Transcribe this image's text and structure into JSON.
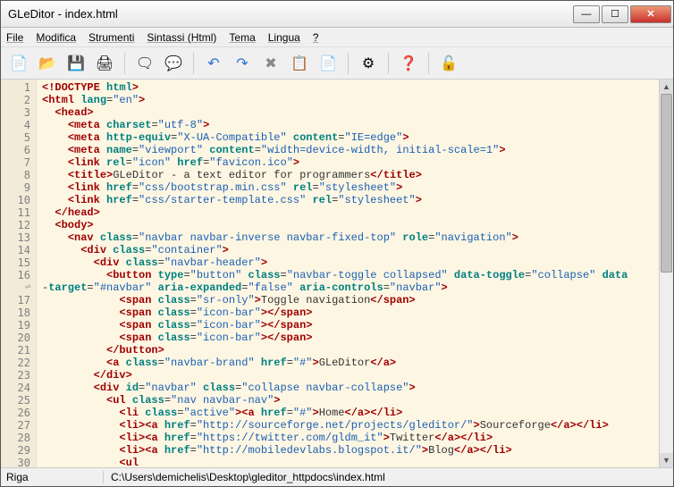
{
  "title": "GLeDitor - index.html",
  "menu": [
    "File",
    "Modifica",
    "Strumenti",
    "Sintassi (Html)",
    "Tema",
    "Lingua",
    "?"
  ],
  "toolbar": [
    {
      "icon": "📄",
      "name": "new-file"
    },
    {
      "icon": "📂",
      "name": "open-file"
    },
    {
      "icon": "💾",
      "name": "save-file"
    },
    {
      "icon": "🖨",
      "name": "print"
    },
    {
      "sep": true
    },
    {
      "icon": "🗨",
      "name": "find"
    },
    {
      "icon": "💬",
      "name": "replace"
    },
    {
      "sep": true
    },
    {
      "icon": "↶",
      "name": "undo",
      "color": "#2a6fd6"
    },
    {
      "icon": "↷",
      "name": "redo",
      "color": "#2a6fd6"
    },
    {
      "icon": "✖",
      "name": "cut",
      "color": "#888"
    },
    {
      "icon": "📋",
      "name": "copy"
    },
    {
      "icon": "📄",
      "name": "paste"
    },
    {
      "sep": true
    },
    {
      "icon": "⚙",
      "name": "settings"
    },
    {
      "sep": true
    },
    {
      "icon": "❓",
      "name": "help",
      "color": "#2a6fd6"
    },
    {
      "sep": true
    },
    {
      "icon": "🔓",
      "name": "lock"
    }
  ],
  "lines": [
    [
      {
        "t": "ang",
        "v": "<!"
      },
      {
        "t": "tag",
        "v": "DOCTYPE"
      },
      {
        "t": "txt",
        "v": " "
      },
      {
        "t": "attr",
        "v": "html"
      },
      {
        "t": "ang",
        "v": ">"
      }
    ],
    [
      {
        "t": "ang",
        "v": "<"
      },
      {
        "t": "tag",
        "v": "html"
      },
      {
        "t": "txt",
        "v": " "
      },
      {
        "t": "attr",
        "v": "lang"
      },
      {
        "t": "txt",
        "v": "="
      },
      {
        "t": "str",
        "v": "\"en\""
      },
      {
        "t": "ang",
        "v": ">"
      }
    ],
    [
      {
        "t": "txt",
        "v": "  "
      },
      {
        "t": "ang",
        "v": "<"
      },
      {
        "t": "tag",
        "v": "head"
      },
      {
        "t": "ang",
        "v": ">"
      }
    ],
    [
      {
        "t": "txt",
        "v": "    "
      },
      {
        "t": "ang",
        "v": "<"
      },
      {
        "t": "tag",
        "v": "meta"
      },
      {
        "t": "txt",
        "v": " "
      },
      {
        "t": "attr",
        "v": "charset"
      },
      {
        "t": "txt",
        "v": "="
      },
      {
        "t": "str",
        "v": "\"utf-8\""
      },
      {
        "t": "ang",
        "v": ">"
      }
    ],
    [
      {
        "t": "txt",
        "v": "    "
      },
      {
        "t": "ang",
        "v": "<"
      },
      {
        "t": "tag",
        "v": "meta"
      },
      {
        "t": "txt",
        "v": " "
      },
      {
        "t": "attr",
        "v": "http-equiv"
      },
      {
        "t": "txt",
        "v": "="
      },
      {
        "t": "str",
        "v": "\"X-UA-Compatible\""
      },
      {
        "t": "txt",
        "v": " "
      },
      {
        "t": "attr",
        "v": "content"
      },
      {
        "t": "txt",
        "v": "="
      },
      {
        "t": "str",
        "v": "\"IE=edge\""
      },
      {
        "t": "ang",
        "v": ">"
      }
    ],
    [
      {
        "t": "txt",
        "v": "    "
      },
      {
        "t": "ang",
        "v": "<"
      },
      {
        "t": "tag",
        "v": "meta"
      },
      {
        "t": "txt",
        "v": " "
      },
      {
        "t": "attr",
        "v": "name"
      },
      {
        "t": "txt",
        "v": "="
      },
      {
        "t": "str",
        "v": "\"viewport\""
      },
      {
        "t": "txt",
        "v": " "
      },
      {
        "t": "attr",
        "v": "content"
      },
      {
        "t": "txt",
        "v": "="
      },
      {
        "t": "str",
        "v": "\"width=device-width, initial-scale=1\""
      },
      {
        "t": "ang",
        "v": ">"
      }
    ],
    [
      {
        "t": "txt",
        "v": "    "
      },
      {
        "t": "ang",
        "v": "<"
      },
      {
        "t": "tag",
        "v": "link"
      },
      {
        "t": "txt",
        "v": " "
      },
      {
        "t": "attr",
        "v": "rel"
      },
      {
        "t": "txt",
        "v": "="
      },
      {
        "t": "str",
        "v": "\"icon\""
      },
      {
        "t": "txt",
        "v": " "
      },
      {
        "t": "attr",
        "v": "href"
      },
      {
        "t": "txt",
        "v": "="
      },
      {
        "t": "str",
        "v": "\"favicon.ico\""
      },
      {
        "t": "ang",
        "v": ">"
      }
    ],
    [
      {
        "t": "txt",
        "v": "    "
      },
      {
        "t": "ang",
        "v": "<"
      },
      {
        "t": "tag",
        "v": "title"
      },
      {
        "t": "ang",
        "v": ">"
      },
      {
        "t": "txt",
        "v": "GLeDitor - a text editor for programmers"
      },
      {
        "t": "ang",
        "v": "</"
      },
      {
        "t": "tag",
        "v": "title"
      },
      {
        "t": "ang",
        "v": ">"
      }
    ],
    [
      {
        "t": "txt",
        "v": "    "
      },
      {
        "t": "ang",
        "v": "<"
      },
      {
        "t": "tag",
        "v": "link"
      },
      {
        "t": "txt",
        "v": " "
      },
      {
        "t": "attr",
        "v": "href"
      },
      {
        "t": "txt",
        "v": "="
      },
      {
        "t": "str",
        "v": "\"css/bootstrap.min.css\""
      },
      {
        "t": "txt",
        "v": " "
      },
      {
        "t": "attr",
        "v": "rel"
      },
      {
        "t": "txt",
        "v": "="
      },
      {
        "t": "str",
        "v": "\"stylesheet\""
      },
      {
        "t": "ang",
        "v": ">"
      }
    ],
    [
      {
        "t": "txt",
        "v": "    "
      },
      {
        "t": "ang",
        "v": "<"
      },
      {
        "t": "tag",
        "v": "link"
      },
      {
        "t": "txt",
        "v": " "
      },
      {
        "t": "attr",
        "v": "href"
      },
      {
        "t": "txt",
        "v": "="
      },
      {
        "t": "str",
        "v": "\"css/starter-template.css\""
      },
      {
        "t": "txt",
        "v": " "
      },
      {
        "t": "attr",
        "v": "rel"
      },
      {
        "t": "txt",
        "v": "="
      },
      {
        "t": "str",
        "v": "\"stylesheet\""
      },
      {
        "t": "ang",
        "v": ">"
      }
    ],
    [
      {
        "t": "txt",
        "v": "  "
      },
      {
        "t": "ang",
        "v": "</"
      },
      {
        "t": "tag",
        "v": "head"
      },
      {
        "t": "ang",
        "v": ">"
      }
    ],
    [
      {
        "t": "txt",
        "v": "  "
      },
      {
        "t": "ang",
        "v": "<"
      },
      {
        "t": "tag",
        "v": "body"
      },
      {
        "t": "ang",
        "v": ">"
      }
    ],
    [
      {
        "t": "txt",
        "v": "    "
      },
      {
        "t": "ang",
        "v": "<"
      },
      {
        "t": "tag",
        "v": "nav"
      },
      {
        "t": "txt",
        "v": " "
      },
      {
        "t": "attr",
        "v": "class"
      },
      {
        "t": "txt",
        "v": "="
      },
      {
        "t": "str",
        "v": "\"navbar navbar-inverse navbar-fixed-top\""
      },
      {
        "t": "txt",
        "v": " "
      },
      {
        "t": "attr",
        "v": "role"
      },
      {
        "t": "txt",
        "v": "="
      },
      {
        "t": "str",
        "v": "\"navigation\""
      },
      {
        "t": "ang",
        "v": ">"
      }
    ],
    [
      {
        "t": "txt",
        "v": "      "
      },
      {
        "t": "ang",
        "v": "<"
      },
      {
        "t": "tag",
        "v": "div"
      },
      {
        "t": "txt",
        "v": " "
      },
      {
        "t": "attr",
        "v": "class"
      },
      {
        "t": "txt",
        "v": "="
      },
      {
        "t": "str",
        "v": "\"container\""
      },
      {
        "t": "ang",
        "v": ">"
      }
    ],
    [
      {
        "t": "txt",
        "v": "        "
      },
      {
        "t": "ang",
        "v": "<"
      },
      {
        "t": "tag",
        "v": "div"
      },
      {
        "t": "txt",
        "v": " "
      },
      {
        "t": "attr",
        "v": "class"
      },
      {
        "t": "txt",
        "v": "="
      },
      {
        "t": "str",
        "v": "\"navbar-header\""
      },
      {
        "t": "ang",
        "v": ">"
      }
    ],
    [
      {
        "t": "txt",
        "v": "          "
      },
      {
        "t": "ang",
        "v": "<"
      },
      {
        "t": "tag",
        "v": "button"
      },
      {
        "t": "txt",
        "v": " "
      },
      {
        "t": "attr",
        "v": "type"
      },
      {
        "t": "txt",
        "v": "="
      },
      {
        "t": "str",
        "v": "\"button\""
      },
      {
        "t": "txt",
        "v": " "
      },
      {
        "t": "attr",
        "v": "class"
      },
      {
        "t": "txt",
        "v": "="
      },
      {
        "t": "str",
        "v": "\"navbar-toggle collapsed\""
      },
      {
        "t": "txt",
        "v": " "
      },
      {
        "t": "attr",
        "v": "data-toggle"
      },
      {
        "t": "txt",
        "v": "="
      },
      {
        "t": "str",
        "v": "\"collapse\""
      },
      {
        "t": "txt",
        "v": " "
      },
      {
        "t": "attr",
        "v": "data"
      }
    ],
    [
      {
        "t": "txt",
        "v": "-"
      },
      {
        "t": "attr",
        "v": "target"
      },
      {
        "t": "txt",
        "v": "="
      },
      {
        "t": "str",
        "v": "\"#navbar\""
      },
      {
        "t": "txt",
        "v": " "
      },
      {
        "t": "attr",
        "v": "aria-expanded"
      },
      {
        "t": "txt",
        "v": "="
      },
      {
        "t": "str",
        "v": "\"false\""
      },
      {
        "t": "txt",
        "v": " "
      },
      {
        "t": "attr",
        "v": "aria-controls"
      },
      {
        "t": "txt",
        "v": "="
      },
      {
        "t": "str",
        "v": "\"navbar\""
      },
      {
        "t": "ang",
        "v": ">"
      }
    ],
    [
      {
        "t": "txt",
        "v": "            "
      },
      {
        "t": "ang",
        "v": "<"
      },
      {
        "t": "tag",
        "v": "span"
      },
      {
        "t": "txt",
        "v": " "
      },
      {
        "t": "attr",
        "v": "class"
      },
      {
        "t": "txt",
        "v": "="
      },
      {
        "t": "str",
        "v": "\"sr-only\""
      },
      {
        "t": "ang",
        "v": ">"
      },
      {
        "t": "txt",
        "v": "Toggle navigation"
      },
      {
        "t": "ang",
        "v": "</"
      },
      {
        "t": "tag",
        "v": "span"
      },
      {
        "t": "ang",
        "v": ">"
      }
    ],
    [
      {
        "t": "txt",
        "v": "            "
      },
      {
        "t": "ang",
        "v": "<"
      },
      {
        "t": "tag",
        "v": "span"
      },
      {
        "t": "txt",
        "v": " "
      },
      {
        "t": "attr",
        "v": "class"
      },
      {
        "t": "txt",
        "v": "="
      },
      {
        "t": "str",
        "v": "\"icon-bar\""
      },
      {
        "t": "ang",
        "v": "></"
      },
      {
        "t": "tag",
        "v": "span"
      },
      {
        "t": "ang",
        "v": ">"
      }
    ],
    [
      {
        "t": "txt",
        "v": "            "
      },
      {
        "t": "ang",
        "v": "<"
      },
      {
        "t": "tag",
        "v": "span"
      },
      {
        "t": "txt",
        "v": " "
      },
      {
        "t": "attr",
        "v": "class"
      },
      {
        "t": "txt",
        "v": "="
      },
      {
        "t": "str",
        "v": "\"icon-bar\""
      },
      {
        "t": "ang",
        "v": "></"
      },
      {
        "t": "tag",
        "v": "span"
      },
      {
        "t": "ang",
        "v": ">"
      }
    ],
    [
      {
        "t": "txt",
        "v": "            "
      },
      {
        "t": "ang",
        "v": "<"
      },
      {
        "t": "tag",
        "v": "span"
      },
      {
        "t": "txt",
        "v": " "
      },
      {
        "t": "attr",
        "v": "class"
      },
      {
        "t": "txt",
        "v": "="
      },
      {
        "t": "str",
        "v": "\"icon-bar\""
      },
      {
        "t": "ang",
        "v": "></"
      },
      {
        "t": "tag",
        "v": "span"
      },
      {
        "t": "ang",
        "v": ">"
      }
    ],
    [
      {
        "t": "txt",
        "v": "          "
      },
      {
        "t": "ang",
        "v": "</"
      },
      {
        "t": "tag",
        "v": "button"
      },
      {
        "t": "ang",
        "v": ">"
      }
    ],
    [
      {
        "t": "txt",
        "v": "          "
      },
      {
        "t": "ang",
        "v": "<"
      },
      {
        "t": "tag",
        "v": "a"
      },
      {
        "t": "txt",
        "v": " "
      },
      {
        "t": "attr",
        "v": "class"
      },
      {
        "t": "txt",
        "v": "="
      },
      {
        "t": "str",
        "v": "\"navbar-brand\""
      },
      {
        "t": "txt",
        "v": " "
      },
      {
        "t": "attr",
        "v": "href"
      },
      {
        "t": "txt",
        "v": "="
      },
      {
        "t": "str",
        "v": "\"#\""
      },
      {
        "t": "ang",
        "v": ">"
      },
      {
        "t": "txt",
        "v": "GLeDitor"
      },
      {
        "t": "ang",
        "v": "</"
      },
      {
        "t": "tag",
        "v": "a"
      },
      {
        "t": "ang",
        "v": ">"
      }
    ],
    [
      {
        "t": "txt",
        "v": "        "
      },
      {
        "t": "ang",
        "v": "</"
      },
      {
        "t": "tag",
        "v": "div"
      },
      {
        "t": "ang",
        "v": ">"
      }
    ],
    [
      {
        "t": "txt",
        "v": "        "
      },
      {
        "t": "ang",
        "v": "<"
      },
      {
        "t": "tag",
        "v": "div"
      },
      {
        "t": "txt",
        "v": " "
      },
      {
        "t": "attr",
        "v": "id"
      },
      {
        "t": "txt",
        "v": "="
      },
      {
        "t": "str",
        "v": "\"navbar\""
      },
      {
        "t": "txt",
        "v": " "
      },
      {
        "t": "attr",
        "v": "class"
      },
      {
        "t": "txt",
        "v": "="
      },
      {
        "t": "str",
        "v": "\"collapse navbar-collapse\""
      },
      {
        "t": "ang",
        "v": ">"
      }
    ],
    [
      {
        "t": "txt",
        "v": "          "
      },
      {
        "t": "ang",
        "v": "<"
      },
      {
        "t": "tag",
        "v": "ul"
      },
      {
        "t": "txt",
        "v": " "
      },
      {
        "t": "attr",
        "v": "class"
      },
      {
        "t": "txt",
        "v": "="
      },
      {
        "t": "str",
        "v": "\"nav navbar-nav\""
      },
      {
        "t": "ang",
        "v": ">"
      }
    ],
    [
      {
        "t": "txt",
        "v": "            "
      },
      {
        "t": "ang",
        "v": "<"
      },
      {
        "t": "tag",
        "v": "li"
      },
      {
        "t": "txt",
        "v": " "
      },
      {
        "t": "attr",
        "v": "class"
      },
      {
        "t": "txt",
        "v": "="
      },
      {
        "t": "str",
        "v": "\"active\""
      },
      {
        "t": "ang",
        "v": "><"
      },
      {
        "t": "tag",
        "v": "a"
      },
      {
        "t": "txt",
        "v": " "
      },
      {
        "t": "attr",
        "v": "href"
      },
      {
        "t": "txt",
        "v": "="
      },
      {
        "t": "str",
        "v": "\"#\""
      },
      {
        "t": "ang",
        "v": ">"
      },
      {
        "t": "txt",
        "v": "Home"
      },
      {
        "t": "ang",
        "v": "</"
      },
      {
        "t": "tag",
        "v": "a"
      },
      {
        "t": "ang",
        "v": "></"
      },
      {
        "t": "tag",
        "v": "li"
      },
      {
        "t": "ang",
        "v": ">"
      }
    ],
    [
      {
        "t": "txt",
        "v": "            "
      },
      {
        "t": "ang",
        "v": "<"
      },
      {
        "t": "tag",
        "v": "li"
      },
      {
        "t": "ang",
        "v": "><"
      },
      {
        "t": "tag",
        "v": "a"
      },
      {
        "t": "txt",
        "v": " "
      },
      {
        "t": "attr",
        "v": "href"
      },
      {
        "t": "txt",
        "v": "="
      },
      {
        "t": "str",
        "v": "\"http://sourceforge.net/projects/gleditor/\""
      },
      {
        "t": "ang",
        "v": ">"
      },
      {
        "t": "txt",
        "v": "Sourceforge"
      },
      {
        "t": "ang",
        "v": "</"
      },
      {
        "t": "tag",
        "v": "a"
      },
      {
        "t": "ang",
        "v": "></"
      },
      {
        "t": "tag",
        "v": "li"
      },
      {
        "t": "ang",
        "v": ">"
      }
    ],
    [
      {
        "t": "txt",
        "v": "            "
      },
      {
        "t": "ang",
        "v": "<"
      },
      {
        "t": "tag",
        "v": "li"
      },
      {
        "t": "ang",
        "v": "><"
      },
      {
        "t": "tag",
        "v": "a"
      },
      {
        "t": "txt",
        "v": " "
      },
      {
        "t": "attr",
        "v": "href"
      },
      {
        "t": "txt",
        "v": "="
      },
      {
        "t": "str",
        "v": "\"https://twitter.com/gldm_it\""
      },
      {
        "t": "ang",
        "v": ">"
      },
      {
        "t": "txt",
        "v": "Twitter"
      },
      {
        "t": "ang",
        "v": "</"
      },
      {
        "t": "tag",
        "v": "a"
      },
      {
        "t": "ang",
        "v": "></"
      },
      {
        "t": "tag",
        "v": "li"
      },
      {
        "t": "ang",
        "v": ">"
      }
    ],
    [
      {
        "t": "txt",
        "v": "            "
      },
      {
        "t": "ang",
        "v": "<"
      },
      {
        "t": "tag",
        "v": "li"
      },
      {
        "t": "ang",
        "v": "><"
      },
      {
        "t": "tag",
        "v": "a"
      },
      {
        "t": "txt",
        "v": " "
      },
      {
        "t": "attr",
        "v": "href"
      },
      {
        "t": "txt",
        "v": "="
      },
      {
        "t": "str",
        "v": "\"http://mobiledevlabs.blogspot.it/\""
      },
      {
        "t": "ang",
        "v": ">"
      },
      {
        "t": "txt",
        "v": "Blog"
      },
      {
        "t": "ang",
        "v": "</"
      },
      {
        "t": "tag",
        "v": "a"
      },
      {
        "t": "ang",
        "v": "></"
      },
      {
        "t": "tag",
        "v": "li"
      },
      {
        "t": "ang",
        "v": ">"
      }
    ],
    [
      {
        "t": "txt",
        "v": "            "
      },
      {
        "t": "ang",
        "v": "<"
      },
      {
        "t": "tag",
        "v": "ul"
      }
    ]
  ],
  "wrapMarker": "⏎",
  "status": {
    "left": "Riga",
    "path": "C:\\Users\\demichelis\\Desktop\\gleditor_httpdocs\\index.html"
  }
}
